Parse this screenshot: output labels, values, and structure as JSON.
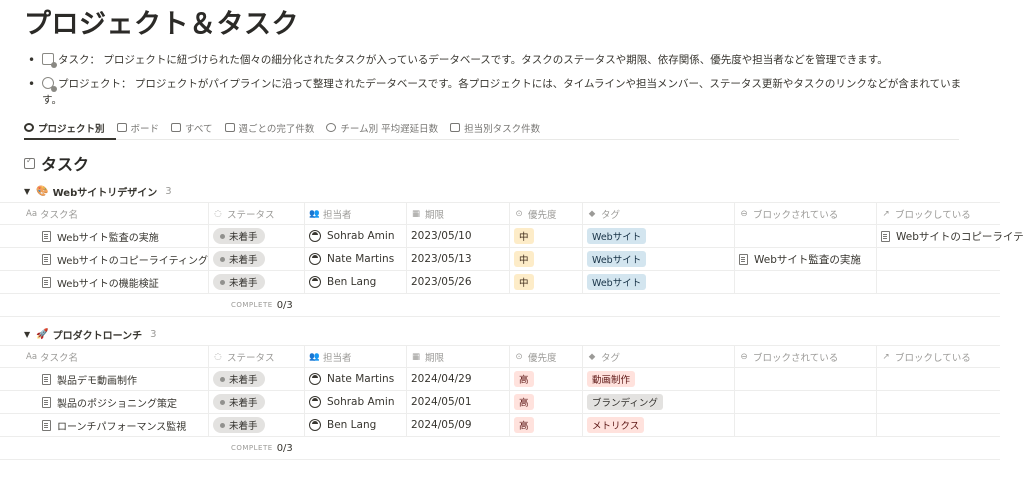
{
  "page_title": "プロジェクト＆タスク",
  "descriptions": [
    {
      "icon": "task-icon",
      "label": "タスク：",
      "text": "プロジェクトに紐づけられた個々の細分化されたタスクが入っているデータベースです。タスクのステータスや期限、依存関係、優先度や担当者などを管理できます。"
    },
    {
      "icon": "project-icon",
      "label": "プロジェクト：",
      "text": "プロジェクトがパイプラインに沿って整理されたデータベースです。各プロジェクトには、タイムラインや担当メンバー、ステータス更新やタスクのリンクなどが含まれています。"
    }
  ],
  "tabs": [
    {
      "label": "プロジェクト別",
      "icon": "target-icon",
      "active": true
    },
    {
      "label": "ボード",
      "icon": "board-icon"
    },
    {
      "label": "すべて",
      "icon": "table-icon"
    },
    {
      "label": "週ごとの完了件数",
      "icon": "line-chart-icon"
    },
    {
      "label": "チーム別 平均遅延日数",
      "icon": "pie-chart-icon"
    },
    {
      "label": "担当別タスク件数",
      "icon": "bar-chart-icon"
    }
  ],
  "section_title": "タスク",
  "columns": [
    {
      "icon": "Aa",
      "label": "タスク名"
    },
    {
      "icon": "◌",
      "label": "ステータス"
    },
    {
      "icon": "👥",
      "label": "担当者"
    },
    {
      "icon": "▦",
      "label": "期限"
    },
    {
      "icon": "⊙",
      "label": "優先度"
    },
    {
      "icon": "◆",
      "label": "タグ"
    },
    {
      "icon": "⊖",
      "label": "ブロックされている"
    },
    {
      "icon": "↗",
      "label": "ブロックしている"
    }
  ],
  "groups": [
    {
      "emoji": "🎨",
      "name": "Webサイトリデザイン",
      "count": "3",
      "complete_label": "COMPLETE",
      "complete_value": "0/3",
      "rows": [
        {
          "name": "Webサイト監査の実施",
          "status": "未着手",
          "assignee": "Sohrab Amin",
          "due": "2023/05/10",
          "priority": "中",
          "tag": "Webサイト",
          "blocked_by": "",
          "blocking": "Webサイトのコピーライテ"
        },
        {
          "name": "Webサイトのコピーライティング",
          "status": "未着手",
          "assignee": "Nate Martins",
          "due": "2023/05/13",
          "priority": "中",
          "tag": "Webサイト",
          "blocked_by": "Webサイト監査の実施",
          "blocking": ""
        },
        {
          "name": "Webサイトの機能検証",
          "status": "未着手",
          "assignee": "Ben Lang",
          "due": "2023/05/26",
          "priority": "中",
          "tag": "Webサイト",
          "blocked_by": "",
          "blocking": ""
        }
      ]
    },
    {
      "emoji": "🚀",
      "name": "プロダクトローンチ",
      "count": "3",
      "complete_label": "COMPLETE",
      "complete_value": "0/3",
      "rows": [
        {
          "name": "製品デモ動画制作",
          "status": "未着手",
          "assignee": "Nate Martins",
          "due": "2024/04/29",
          "priority": "高",
          "tag": "動画制作",
          "blocked_by": "",
          "blocking": ""
        },
        {
          "name": "製品のポジショニング策定",
          "status": "未着手",
          "assignee": "Sohrab Amin",
          "due": "2024/05/01",
          "priority": "高",
          "tag": "ブランディング",
          "blocked_by": "",
          "blocking": ""
        },
        {
          "name": "ローンチパフォーマンス監視",
          "status": "未着手",
          "assignee": "Ben Lang",
          "due": "2024/05/09",
          "priority": "高",
          "tag": "メトリクス",
          "blocked_by": "",
          "blocking": ""
        }
      ]
    }
  ],
  "colors": {
    "status_bg": "#e3e2e0",
    "priority_mid": "#fdecc8",
    "priority_high": "#ffe2dd",
    "tag_web": "#d3e5ef"
  }
}
